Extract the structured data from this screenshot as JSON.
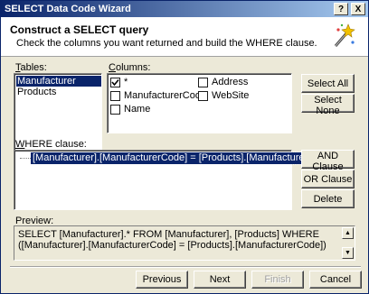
{
  "window": {
    "title": "SELECT Data Code Wizard",
    "help_btn": "?",
    "close_btn": "X"
  },
  "header": {
    "title": "Construct a SELECT query",
    "subtitle": "Check the columns you want returned and build the WHERE clause."
  },
  "tables": {
    "label_u": "T",
    "label_rest": "ables:",
    "items": [
      {
        "label": "Manufacturer",
        "selected": true
      },
      {
        "label": "Products",
        "selected": false
      }
    ]
  },
  "columns": {
    "label_u": "C",
    "label_rest": "olumns:",
    "items": [
      {
        "label": "*",
        "checked": true
      },
      {
        "label": "ManufacturerCode",
        "checked": false
      },
      {
        "label": "Name",
        "checked": false
      },
      {
        "label": "Address",
        "checked": false
      },
      {
        "label": "WebSite",
        "checked": false
      }
    ]
  },
  "buttons": {
    "select_all": "Select All",
    "select_none": "Select None",
    "and_clause": "AND Clause",
    "or_clause": "OR Clause",
    "delete": "Delete",
    "previous": "Previous",
    "next": "Next",
    "finish": "Finish",
    "cancel": "Cancel"
  },
  "where": {
    "label_u": "W",
    "label_rest": "HERE clause:",
    "row": "[Manufacturer].[ManufacturerCode] = [Products].[ManufacturerCode]"
  },
  "preview": {
    "label": "Preview:",
    "text": "SELECT [Manufacturer].* FROM [Manufacturer], [Products] WHERE ([Manufacturer].[ManufacturerCode] = [Products].[ManufacturerCode])"
  }
}
